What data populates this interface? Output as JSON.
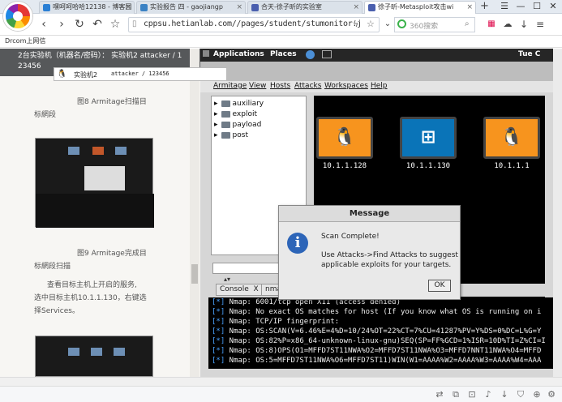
{
  "browser": {
    "tabs": [
      {
        "title": "嘿呵呵哈哈12138 - 博客园",
        "active": false,
        "icon_color": "#2a7fd4"
      },
      {
        "title": "实验报告 四 - gaojiangp",
        "active": false,
        "icon_color": "#3b82c4"
      },
      {
        "title": "合天-徐子昕的实验室",
        "active": false,
        "icon_color": "#4a5fae"
      },
      {
        "title": "徐子昕-Metasploit攻击wi",
        "active": true,
        "icon_color": "#4a5fae"
      }
    ],
    "new_tab": "+",
    "window_buttons": [
      "☰",
      "—",
      "☐",
      "✕"
    ],
    "url": "cppsu.hetianlab.com//pages/student/stumonitor.j",
    "search_placeholder": "360搜索",
    "bookmark": "Drcom上网信"
  },
  "article": {
    "header_line1": "2台实验机（机器名/密码）：   实验机2   attacker / 1",
    "header_line2": "23456",
    "caption8": "图8 Armitage扫描目",
    "caption8b": "标網段",
    "caption9": "图9 Armitage完成目",
    "caption9b": "标網段扫描",
    "para1": "查看目标主机上开启的服务,",
    "para2": "选中目标主机10.1.1.130，右键选",
    "para3": "择Services。"
  },
  "vm_popup": {
    "label": "实验机2",
    "creds": "attacker / 123456"
  },
  "gnome": {
    "applications": "Applications",
    "places": "Places",
    "clock": "Tue C"
  },
  "armitage": {
    "menu": [
      "Armitage",
      "View",
      "Hosts",
      "Attacks",
      "Workspaces",
      "Help"
    ],
    "modules": [
      "auxiliary",
      "exploit",
      "payload",
      "post"
    ],
    "hosts": [
      {
        "ip": "10.1.1.128",
        "os": "linux-icon"
      },
      {
        "ip": "10.1.1.130",
        "os": "windows-icon"
      },
      {
        "ip": "10.1.1.1",
        "os": "linux-icon"
      }
    ],
    "tabs": [
      "Console",
      "X",
      "nma"
    ],
    "console": [
      "[*] Nmap: 6001/tcp open  X11    (access denied)",
      "[*] Nmap: No exact OS matches for host (If you know what OS is running on i",
      "[*] Nmap: TCP/IP fingerprint:",
      "[*] Nmap: OS:SCAN(V=6.46%E=4%D=10/24%OT=22%CT=7%CU=41287%PV=Y%DS=0%DC=L%G=Y",
      "[*] Nmap: OS:82%P=x86_64-unknown-linux-gnu)SEQ(SP=FF%GCD=1%ISR=10D%TI=Z%CI=I",
      "[*] Nmap: OS:8)OPS(O1=MFFD7ST11NWA%O2=MFFD7ST11NWA%O3=MFFD7NNT11NWA%O4=MFFD",
      "[*] Nmap: OS:5=MFFD7ST11NWA%O6=MFFD7ST11)WIN(W1=AAAA%W2=AAAA%W3=AAAA%W4=AAA"
    ]
  },
  "dialog": {
    "title": "Message",
    "line1": "Scan Complete!",
    "line2": "Use Attacks->Find Attacks to suggest",
    "line3": "applicable exploits for your targets.",
    "ok": "OK"
  },
  "colors": {
    "linux_monitor": "#f7941e",
    "windows_monitor": "#0a74b8",
    "console_prefix": "#4aa3ff"
  }
}
